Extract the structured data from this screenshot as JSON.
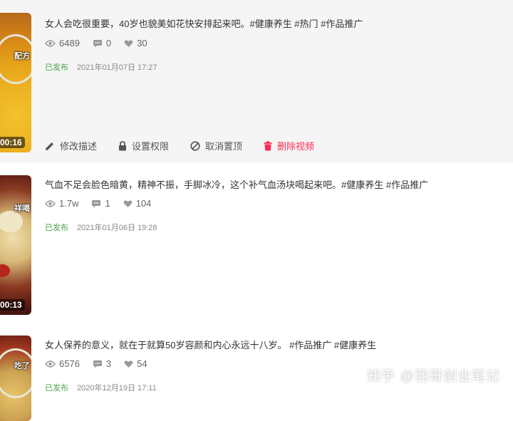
{
  "videos": [
    {
      "title": "女人会吃很重要，40岁也貌美如花快安排起来吧。#健康养生 #热门 #作品推广",
      "views": "6489",
      "comments": "0",
      "likes": "30",
      "status": "已发布",
      "date": "2021年01月07日 17:27",
      "duration": "00:16",
      "thumb_text": "配方"
    },
    {
      "title": "气血不足会脸色暗黄，精神不振，手脚冰冷，这个补气血汤块喝起来吧。#健康养生 #作品推广",
      "views": "1.7w",
      "comments": "1",
      "likes": "104",
      "status": "已发布",
      "date": "2021年01月06日 19:28",
      "duration": "00:13",
      "thumb_text": "祥喝"
    },
    {
      "title": "女人保养的意义，就在于就算50岁容颜和内心永远十八岁。 #作品推广 #健康养生",
      "views": "6576",
      "comments": "3",
      "likes": "54",
      "status": "已发布",
      "date": "2020年12月19日 17:11",
      "thumb_text": "吃了"
    }
  ],
  "actions": {
    "edit": "修改描述",
    "permission": "设置权限",
    "unpin": "取消置顶",
    "delete": "删除视频"
  },
  "colors": {
    "published": "#47a447",
    "delete": "#fe2c55",
    "hover_bg": "#f5f5f5"
  },
  "watermark": "知乎 @羽哥创业笔记"
}
